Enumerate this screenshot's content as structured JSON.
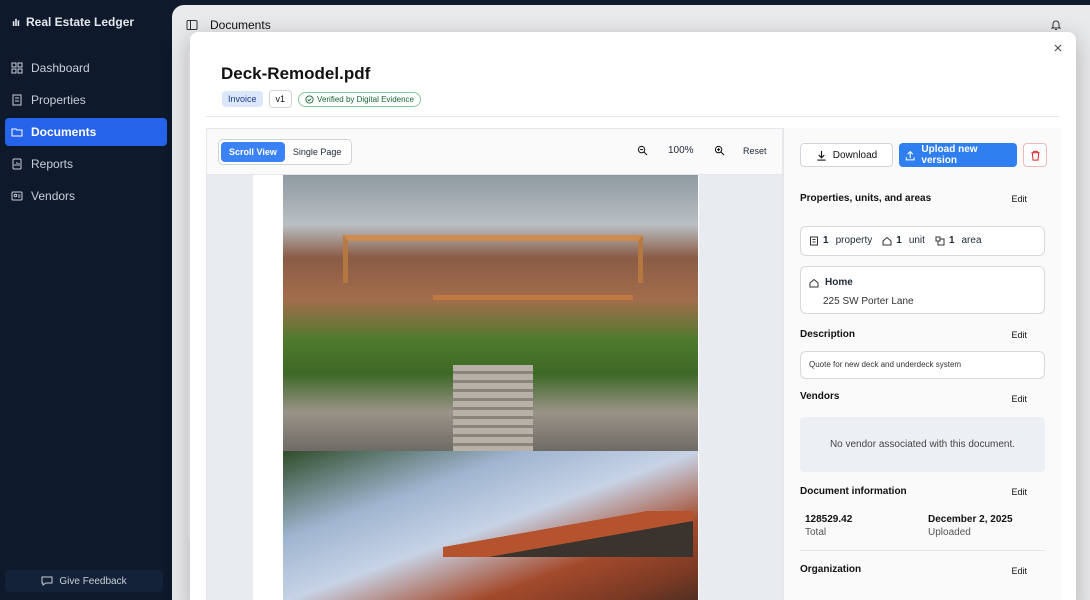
{
  "sidebar": {
    "brand": "Real Estate Ledger",
    "items": [
      {
        "label": "Dashboard",
        "icon": "grid-icon",
        "active": false
      },
      {
        "label": "Properties",
        "icon": "building-icon",
        "active": false
      },
      {
        "label": "Documents",
        "icon": "folder-icon",
        "active": true
      },
      {
        "label": "Reports",
        "icon": "chart-icon",
        "active": false
      },
      {
        "label": "Vendors",
        "icon": "vendor-icon",
        "active": false
      }
    ],
    "feedback_label": "Give Feedback"
  },
  "header": {
    "breadcrumb": "Documents"
  },
  "modal": {
    "title": "Deck-Remodel.pdf",
    "badges": {
      "type": "Invoice",
      "version": "v1",
      "verified": "Verified by Digital Evidence"
    },
    "viewer": {
      "mode_scroll": "Scroll View",
      "mode_single": "Single Page",
      "zoom": "100%",
      "reset": "Reset"
    },
    "actions": {
      "download": "Download",
      "upload": "Upload new version"
    },
    "properties": {
      "title": "Properties, units, and areas",
      "edit": "Edit",
      "property_count": "1",
      "property_label": "property",
      "unit_count": "1",
      "unit_label": "unit",
      "area_count": "1",
      "area_label": "area",
      "home_name": "Home",
      "home_address": "225 SW Porter Lane"
    },
    "description": {
      "title": "Description",
      "edit": "Edit",
      "text": "Quote for new deck and underdeck system"
    },
    "vendors": {
      "title": "Vendors",
      "edit": "Edit",
      "empty": "No vendor associated with this document."
    },
    "document_info": {
      "title": "Document information",
      "edit": "Edit",
      "total_value": "128529.42",
      "total_label": "Total",
      "uploaded_value": "December 2, 2025",
      "uploaded_label": "Uploaded"
    },
    "organization": {
      "title": "Organization",
      "edit": "Edit"
    }
  },
  "colors": {
    "accent": "#2f7ff0",
    "sidebar_bg": "#0e1a2c",
    "danger": "#dc2626",
    "verified": "#166534"
  }
}
